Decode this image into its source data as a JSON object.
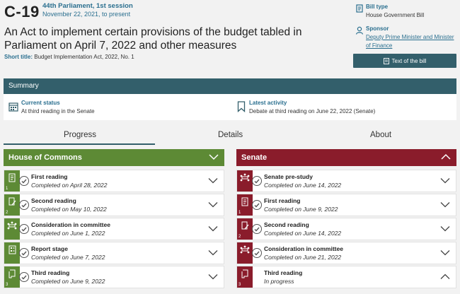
{
  "bill": {
    "number": "C-19",
    "session": "44th Parliament, 1st session",
    "dates": "November 22, 2021, to present",
    "long_title": "An Act to implement certain provisions of the budget tabled in Parliament on April 7, 2022 and other measures",
    "short_title_label": "Short title:",
    "short_title": "Budget Implementation Act, 2022, No. 1"
  },
  "side": {
    "bill_type_label": "Bill type",
    "bill_type": "House Government Bill",
    "sponsor_label": "Sponsor",
    "sponsor": "Deputy Prime Minister and Minister of Finance",
    "text_button": "Text of the bill"
  },
  "summary": {
    "title": "Summary",
    "current_status_label": "Current status",
    "current_status": "At third reading in the Senate",
    "latest_activity_label": "Latest activity",
    "latest_activity": "Debate at third reading on June 22, 2022 (Senate)"
  },
  "tabs": [
    "Progress",
    "Details",
    "About"
  ],
  "house": {
    "title": "House of Commons",
    "stages": [
      {
        "title": "First reading",
        "sub": "Completed on April 28, 2022",
        "num": "1"
      },
      {
        "title": "Second reading",
        "sub": "Completed on May 10, 2022",
        "num": "2"
      },
      {
        "title": "Consideration in committee",
        "sub": "Completed on June 1, 2022",
        "num": ""
      },
      {
        "title": "Report stage",
        "sub": "Completed on June 7, 2022",
        "num": ""
      },
      {
        "title": "Third reading",
        "sub": "Completed on June 9, 2022",
        "num": "3"
      }
    ]
  },
  "senate": {
    "title": "Senate",
    "stages": [
      {
        "title": "Senate pre-study",
        "sub": "Completed on June 14, 2022",
        "num": ""
      },
      {
        "title": "First reading",
        "sub": "Completed on June 9, 2022",
        "num": "1"
      },
      {
        "title": "Second reading",
        "sub": "Completed on June 14, 2022",
        "num": "2"
      },
      {
        "title": "Consideration in committee",
        "sub": "Completed on June 21, 2022",
        "num": ""
      },
      {
        "title": "Third reading",
        "sub": "In progress",
        "num": "3"
      }
    ]
  },
  "colors": {
    "house": "#5d8a35",
    "senate": "#8a1c2b",
    "accent": "#335f6b",
    "link": "#2a6f8f"
  }
}
